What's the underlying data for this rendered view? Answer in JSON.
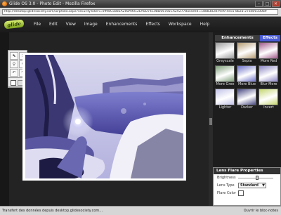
{
  "window": {
    "title": "Glide OS 3.0 - Photo Edit - Mozilla Firefox"
  },
  "browser": {
    "url": "http://desktop.glidesociety.com/ui/photo.aspx?securityToken=0998C5885A200A9012EA0D74C0BD06785CA2A2778assetId=18883028:f9d9-4ec5-8b2b-27afaf0330b9"
  },
  "app": {
    "logo": "glide",
    "menu": [
      "File",
      "Edit",
      "View",
      "Image",
      "Enhancements",
      "Effects",
      "Workspace",
      "Help"
    ]
  },
  "tools": [
    "⬉",
    "✕",
    "⚲",
    "⚲",
    "↶",
    "↷"
  ],
  "panel": {
    "tabs": [
      "Enhancements",
      "Effects"
    ],
    "thumbnails": [
      {
        "label": "Greyscale",
        "tint": "#9a9a9a"
      },
      {
        "label": "Sepia",
        "tint": "#b39a70"
      },
      {
        "label": "More Red",
        "tint": "#a05a8a"
      },
      {
        "label": "More Gree",
        "tint": "#7f9f7a"
      },
      {
        "label": "More Blue",
        "tint": "#6f72c8"
      },
      {
        "label": "Blur More",
        "tint": "#8c86c4"
      },
      {
        "label": "Lighter",
        "tint": "#c2c2e8"
      },
      {
        "label": "Darker",
        "tint": "#4a4a82"
      },
      {
        "label": "Invert",
        "tint": "#c4d670"
      }
    ]
  },
  "lens_flare": {
    "title": "Lens Flare Properties",
    "brightness_label": "Brightness",
    "brightness_value": 0.55,
    "lens_type_label": "Lens Type",
    "lens_type_value": "Standard",
    "flare_color_label": "Flare Color",
    "flare_color": "#ffffff"
  },
  "status": {
    "message": "Transfert des données depuis desktop.glidesociety.com...",
    "right": "Ouvrir le bloc-notes"
  }
}
